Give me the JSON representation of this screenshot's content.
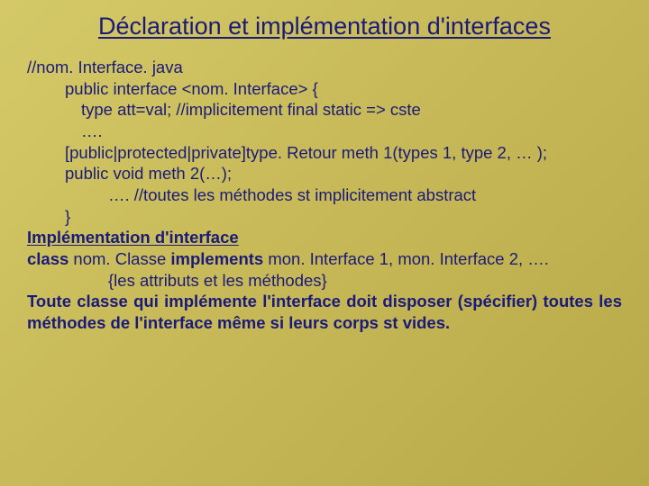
{
  "title": "Déclaration et implémentation d'interfaces",
  "lines": {
    "l1": "//nom. Interface. java",
    "l2": "public interface <nom. Interface> {",
    "l3": "type att=val; //implicitement final static => cste",
    "l4": "….",
    "l5": "[public|protected|private]type. Retour meth 1(types 1, type 2, … );",
    "l6": "public void meth 2(…);",
    "l7": "…. //toutes les méthodes st implicitement abstract",
    "l8": "}",
    "impl_head": "Implémentation d'interface",
    "cls1": "class",
    "cls2": " nom. Classe ",
    "cls3": "implements",
    "cls4": " mon. Interface 1, mon. Interface 2, ….",
    "l9": "{les attributs et les méthodes}",
    "note": "Toute classe qui implémente l'interface doit disposer (spécifier) toutes les méthodes de l'interface même si leurs corps st vides."
  }
}
